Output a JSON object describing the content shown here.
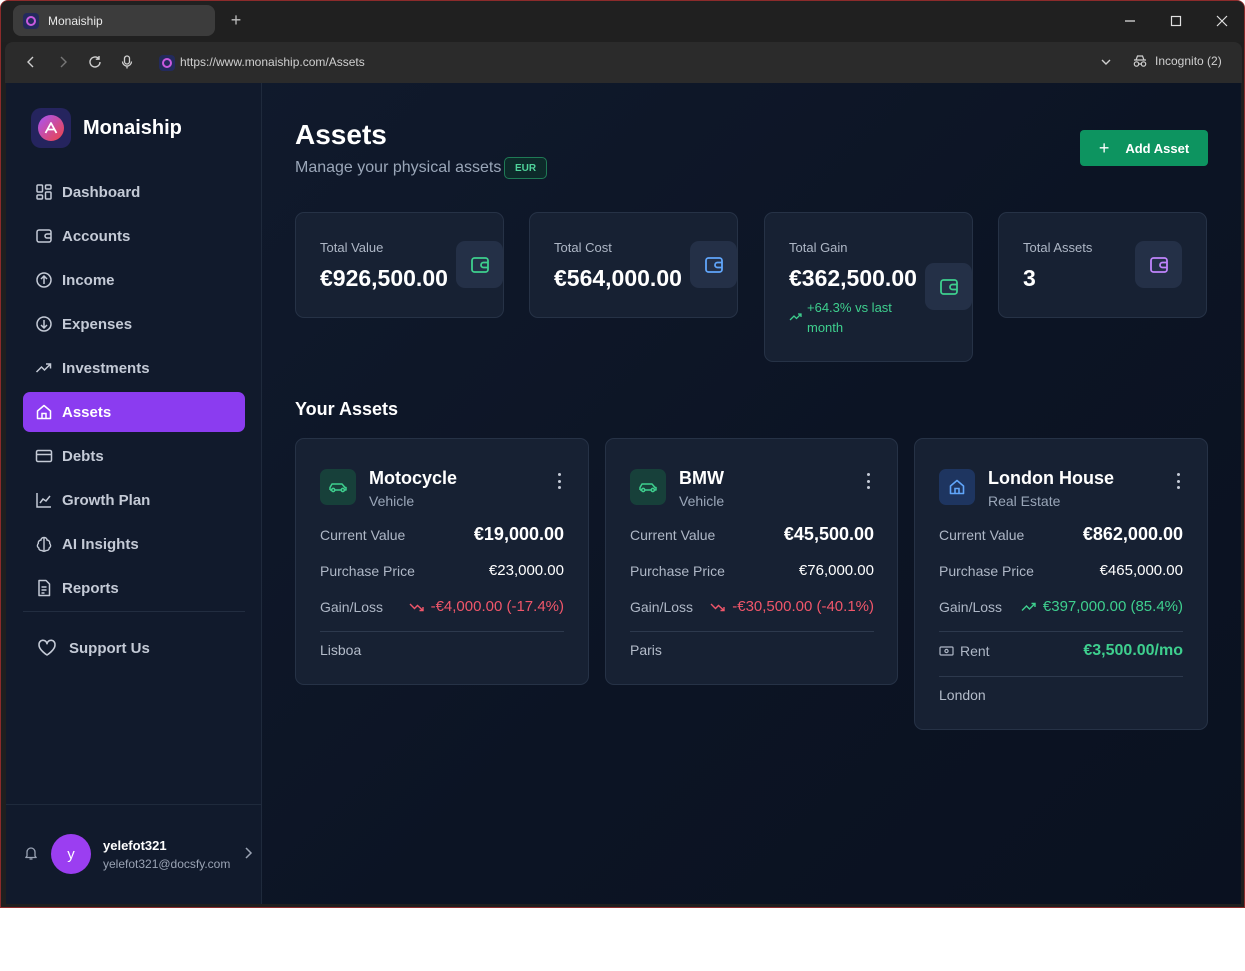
{
  "browser": {
    "tab_title": "Monaiship",
    "new_tab": "+",
    "url": "https://www.monaiship.com/Assets",
    "incognito": "Incognito (2)"
  },
  "sidebar": {
    "brand": "Monaiship",
    "items": [
      {
        "label": "Dashboard",
        "icon": "dashboard-icon"
      },
      {
        "label": "Accounts",
        "icon": "wallet-icon"
      },
      {
        "label": "Income",
        "icon": "arrow-up-circle-icon"
      },
      {
        "label": "Expenses",
        "icon": "arrow-down-circle-icon"
      },
      {
        "label": "Investments",
        "icon": "trending-up-icon"
      },
      {
        "label": "Assets",
        "icon": "home-icon",
        "active": true
      },
      {
        "label": "Debts",
        "icon": "credit-card-icon"
      },
      {
        "label": "Growth Plan",
        "icon": "chart-line-icon"
      },
      {
        "label": "AI Insights",
        "icon": "brain-icon"
      },
      {
        "label": "Reports",
        "icon": "file-text-icon"
      }
    ],
    "support": "Support Us",
    "user": {
      "avatar_letter": "y",
      "name": "yelefot321",
      "email": "yelefot321@docsfy.com"
    }
  },
  "main": {
    "title": "Assets",
    "subtitle": "Manage your physical assets",
    "currency": "EUR",
    "add_button": "Add Asset",
    "stats": [
      {
        "label": "Total Value",
        "value": "€926,500.00",
        "icon_color": "#3ecf8e"
      },
      {
        "label": "Total Cost",
        "value": "€564,000.00",
        "icon_color": "#60a5fa"
      },
      {
        "label": "Total Gain",
        "value": "€362,500.00",
        "icon_color": "#3ecf8e",
        "change": "+64.3% vs last month"
      },
      {
        "label": "Total Assets",
        "value": "3",
        "icon_color": "#c084fc"
      }
    ],
    "assets_heading": "Your Assets",
    "assets": [
      {
        "name": "Motocycle",
        "category": "Vehicle",
        "current_value_label": "Current Value",
        "current_value": "€19,000.00",
        "purchase_label": "Purchase Price",
        "purchase_price": "€23,000.00",
        "gain_label": "Gain/Loss",
        "gain_loss": "-€4,000.00 (-17.4%)",
        "location": "Lisboa"
      },
      {
        "name": "BMW",
        "category": "Vehicle",
        "current_value_label": "Current Value",
        "current_value": "€45,500.00",
        "purchase_label": "Purchase Price",
        "purchase_price": "€76,000.00",
        "gain_label": "Gain/Loss",
        "gain_loss": "-€30,500.00 (-40.1%)",
        "location": "Paris"
      },
      {
        "name": "London House",
        "category": "Real Estate",
        "current_value_label": "Current Value",
        "current_value": "€862,000.00",
        "purchase_label": "Purchase Price",
        "purchase_price": "€465,000.00",
        "gain_label": "Gain/Loss",
        "gain_loss": "€397,000.00 (85.4%)",
        "rent_label": "Rent",
        "rent": "€3,500.00/mo",
        "location": "London"
      }
    ]
  }
}
